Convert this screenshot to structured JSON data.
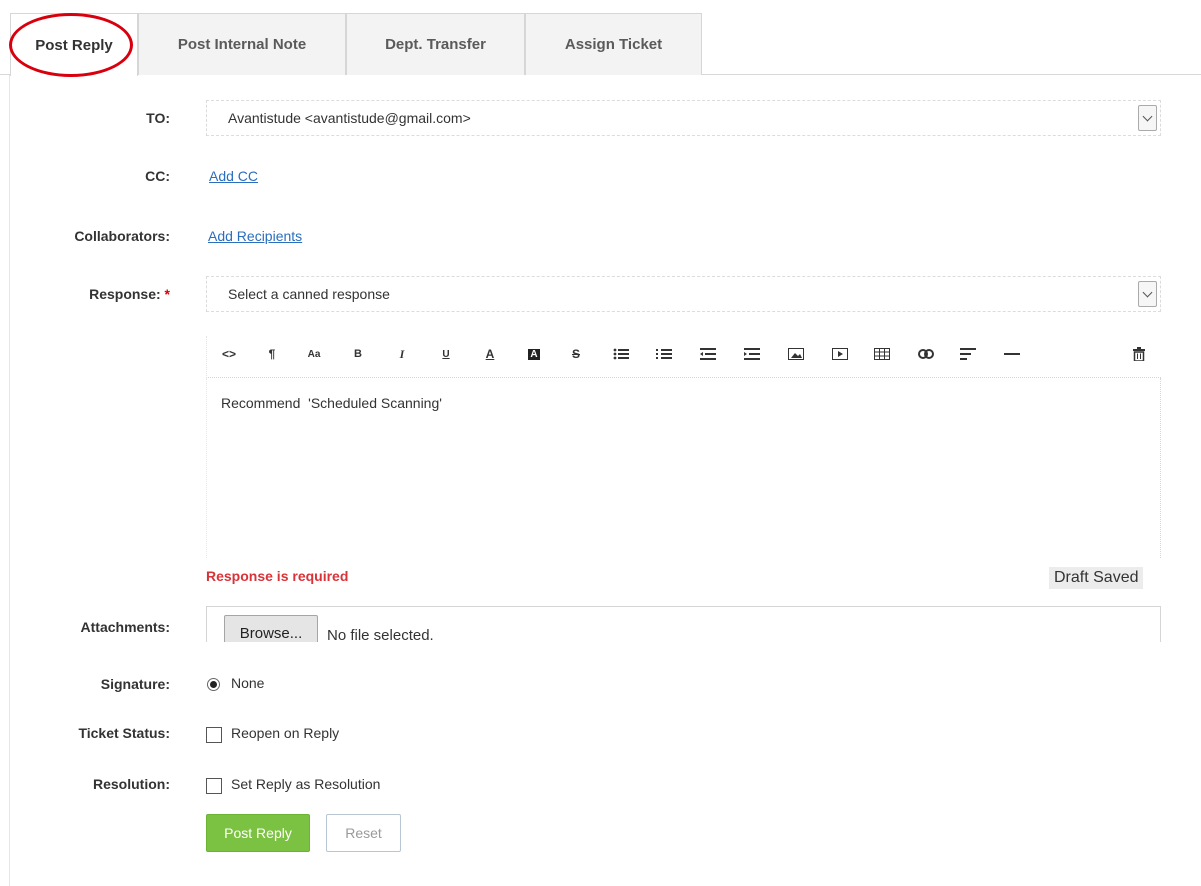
{
  "tabs": [
    {
      "label": "Post Reply",
      "active": true
    },
    {
      "label": "Post Internal Note",
      "active": false
    },
    {
      "label": "Dept. Transfer",
      "active": false
    },
    {
      "label": "Assign Ticket",
      "active": false
    }
  ],
  "form": {
    "to": {
      "label": "TO:",
      "value": "Avantistude <avantistude@gmail.com>"
    },
    "cc": {
      "label": "CC:",
      "link": "Add CC"
    },
    "collaborators": {
      "label": "Collaborators:",
      "link": "Add Recipients"
    },
    "response": {
      "label": "Response:",
      "required_mark": "*",
      "placeholder": "Select a canned response"
    },
    "editor": {
      "body": "Recommend  'Scheduled Scanning'",
      "toolbar": {
        "code": "<>",
        "paragraph": "¶",
        "font_size": "Aa",
        "bold": "B",
        "italic": "I",
        "underline": "U",
        "font_color": "A",
        "background_color": "A",
        "strikethrough": "S"
      }
    },
    "error": "Response is required",
    "draft_status": "Draft Saved",
    "attachments": {
      "label": "Attachments:",
      "browse": "Browse...",
      "status": "No file selected."
    },
    "signature": {
      "label": "Signature:",
      "option": "None",
      "selected": true
    },
    "ticket_status": {
      "label": "Ticket Status:",
      "option": "Reopen on Reply",
      "checked": false
    },
    "resolution": {
      "label": "Resolution:",
      "option": "Set Reply as Resolution",
      "checked": false
    },
    "buttons": {
      "submit": "Post Reply",
      "reset": "Reset"
    }
  },
  "colors": {
    "highlight": "#d9000d",
    "primary": "#7cc242",
    "link": "#2a6ebd",
    "error": "#d9333a"
  }
}
